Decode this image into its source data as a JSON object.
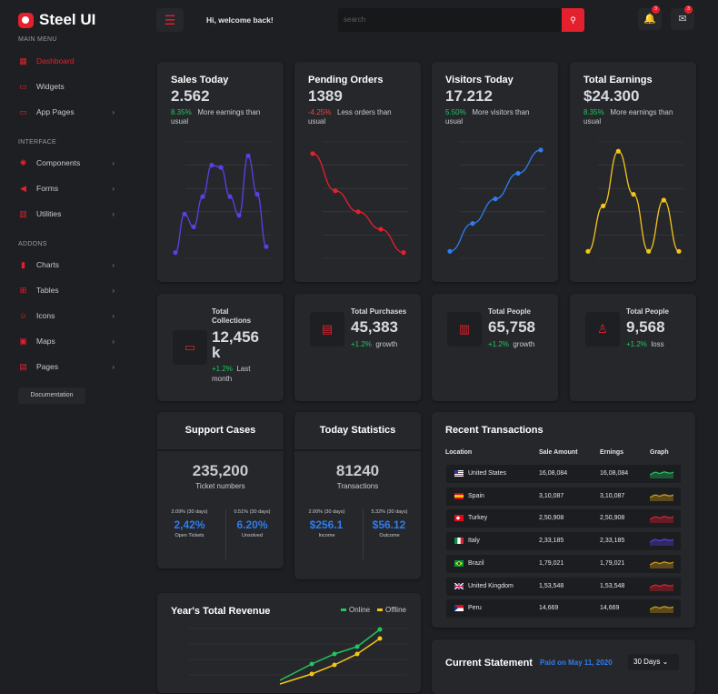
{
  "app": {
    "name": "Steel UI"
  },
  "sidebar": {
    "sections": [
      {
        "title": "MAIN MENU",
        "items": [
          {
            "label": "Dashboard",
            "icon": "grid-icon",
            "active": true
          },
          {
            "label": "Widgets",
            "icon": "monitor-icon"
          },
          {
            "label": "App Pages",
            "icon": "monitor-icon",
            "chevron": true
          }
        ]
      },
      {
        "title": "INTERFACE",
        "items": [
          {
            "label": "Components",
            "icon": "gear-icon",
            "chevron": true
          },
          {
            "label": "Forms",
            "icon": "megaphone-icon",
            "chevron": true
          },
          {
            "label": "Utilities",
            "icon": "building-icon",
            "chevron": true
          }
        ]
      },
      {
        "title": "ADDONS",
        "items": [
          {
            "label": "Charts",
            "icon": "chart-icon",
            "chevron": true
          },
          {
            "label": "Tables",
            "icon": "table-icon",
            "chevron": true
          },
          {
            "label": "Icons",
            "icon": "smile-icon",
            "chevron": true
          },
          {
            "label": "Maps",
            "icon": "map-icon",
            "chevron": true
          },
          {
            "label": "Pages",
            "icon": "file-icon",
            "chevron": true
          }
        ]
      }
    ],
    "doc_button": "Documentation"
  },
  "topbar": {
    "welcome": "Hi, welcome back!",
    "search_placeholder": "search",
    "notif_count": "3",
    "mail_count": "3"
  },
  "stats": [
    {
      "title": "Sales Today",
      "value": "2.562",
      "pct": "8.35%",
      "pct_type": "up",
      "desc": "More earnings than usual",
      "color": "#5b3ee6",
      "spark": [
        0.05,
        0.38,
        0.27,
        0.53,
        0.8,
        0.78,
        0.53,
        0.37,
        0.88,
        0.55,
        0.1
      ]
    },
    {
      "title": "Pending Orders",
      "value": "1389",
      "pct": "-4.25%",
      "pct_type": "down",
      "desc": "Less orders than usual",
      "color": "#e5202e",
      "spark": [
        0.9,
        0.58,
        0.4,
        0.25,
        0.05
      ]
    },
    {
      "title": "Visitors Today",
      "value": "17.212",
      "pct": "5.50%",
      "pct_type": "up",
      "desc": "More visitors than usual",
      "color": "#2f7dee",
      "spark": [
        0.06,
        0.3,
        0.51,
        0.73,
        0.93
      ]
    },
    {
      "title": "Total Earnings",
      "value": "$24.300",
      "pct": "8.35%",
      "pct_type": "up",
      "desc": "More earnings than usual",
      "color": "#f5c518",
      "spark": [
        0.06,
        0.45,
        0.92,
        0.55,
        0.06,
        0.5,
        0.06
      ]
    }
  ],
  "minis": [
    {
      "title": "Total Collections",
      "value": "12,456 k",
      "pct": "+1.2%",
      "sub": "Last month",
      "icon": "folder-icon"
    },
    {
      "title": "Total Purchases",
      "value": "45,383",
      "pct": "+1.2%",
      "sub": "growth",
      "icon": "clipboard-icon"
    },
    {
      "title": "Total People",
      "value": "65,758",
      "pct": "+1.2%",
      "sub": "growth",
      "icon": "document-icon"
    },
    {
      "title": "Total People",
      "value": "9,568",
      "pct": "+1.2%",
      "sub": "loss",
      "icon": "user-icon"
    }
  ],
  "support": {
    "title": "Support Cases",
    "big": "235,200",
    "sub": "Ticket numbers",
    "left": {
      "small": "2.09% (30 days)",
      "value": "2,42%",
      "label": "Open Tickets"
    },
    "right": {
      "small": "0.51% (30 days)",
      "value": "6.20%",
      "label": "Unsolved"
    }
  },
  "today": {
    "title": "Today Statistics",
    "big": "81240",
    "sub": "Transactions",
    "left": {
      "small": "2.00% (30 days)",
      "value": "$256.1",
      "label": "Income"
    },
    "right": {
      "small": "5.32% (30 days)",
      "value": "$56.12",
      "label": "Outcome"
    }
  },
  "transactions": {
    "title": "Recent Transactions",
    "headers": [
      "Location",
      "Sale Amount",
      "Ernings",
      "Graph"
    ],
    "rows": [
      {
        "country": "United States",
        "sale": "16,08,084",
        "earn": "16,08,084",
        "color": "#22c55e"
      },
      {
        "country": "Spain",
        "sale": "3,10,087",
        "earn": "3,10,087",
        "color": "#d4a017"
      },
      {
        "country": "Turkey",
        "sale": "2,50,908",
        "earn": "2,50,908",
        "color": "#e5202e"
      },
      {
        "country": "Italy",
        "sale": "2,33,185",
        "earn": "2,33,185",
        "color": "#5b3ee6"
      },
      {
        "country": "Brazil",
        "sale": "1,79,021",
        "earn": "1,79,021",
        "color": "#d4a017"
      },
      {
        "country": "United Kingdom",
        "sale": "1,53,548",
        "earn": "1,53,548",
        "color": "#e5202e"
      },
      {
        "country": "Peru",
        "sale": "14,669",
        "earn": "14,669",
        "color": "#d4a017"
      }
    ]
  },
  "revenue": {
    "title": "Year's Total Revenue",
    "legend": [
      {
        "name": "Online",
        "color": "#22c55e"
      },
      {
        "name": "Offline",
        "color": "#f5c518"
      }
    ]
  },
  "statement": {
    "title": "Current Statement",
    "date": "Paid on May 11, 2020",
    "range": "30 Days"
  }
}
